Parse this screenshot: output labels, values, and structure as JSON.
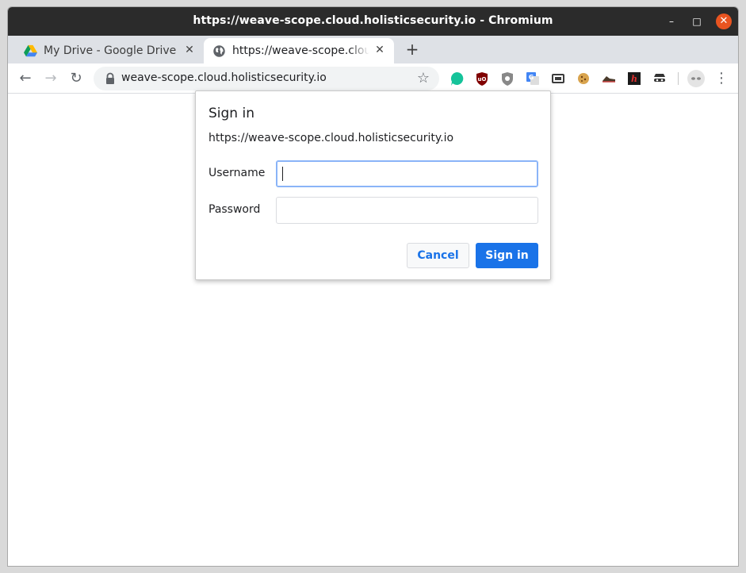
{
  "window": {
    "title": "https://weave-scope.cloud.holisticsecurity.io - Chromium",
    "minimize_glyph": "–",
    "maximize_glyph": "□",
    "close_glyph": "✕"
  },
  "tabs": [
    {
      "label": "My Drive - Google Drive",
      "icon": "google-drive-icon",
      "close_glyph": "✕"
    },
    {
      "label": "https://weave-scope.cloud.holisticsecurity.io",
      "icon": "globe-icon",
      "close_glyph": "✕"
    }
  ],
  "new_tab_glyph": "+",
  "toolbar": {
    "back_glyph": "←",
    "forward_glyph": "→",
    "reload_glyph": "↻",
    "url": "weave-scope.cloud.holisticsecurity.io",
    "star_glyph": "☆",
    "menu_glyph": "⋮",
    "extensions": [
      "grammarly-icon",
      "ublock-icon",
      "privacy-badger-icon",
      "google-translate-icon",
      "screenshot-icon",
      "cookie-icon",
      "shoe-icon",
      "hackbar-icon",
      "incognito-mask-icon"
    ]
  },
  "dialog": {
    "title": "Sign in",
    "origin": "https://weave-scope.cloud.holisticsecurity.io",
    "username_label": "Username",
    "username_value": "",
    "password_label": "Password",
    "password_value": "",
    "cancel_label": "Cancel",
    "signin_label": "Sign in"
  },
  "colors": {
    "titlebar": "#2b2b2b",
    "tabstrip": "#dee1e6",
    "accent": "#1a73e8",
    "close_button": "#e95420"
  }
}
